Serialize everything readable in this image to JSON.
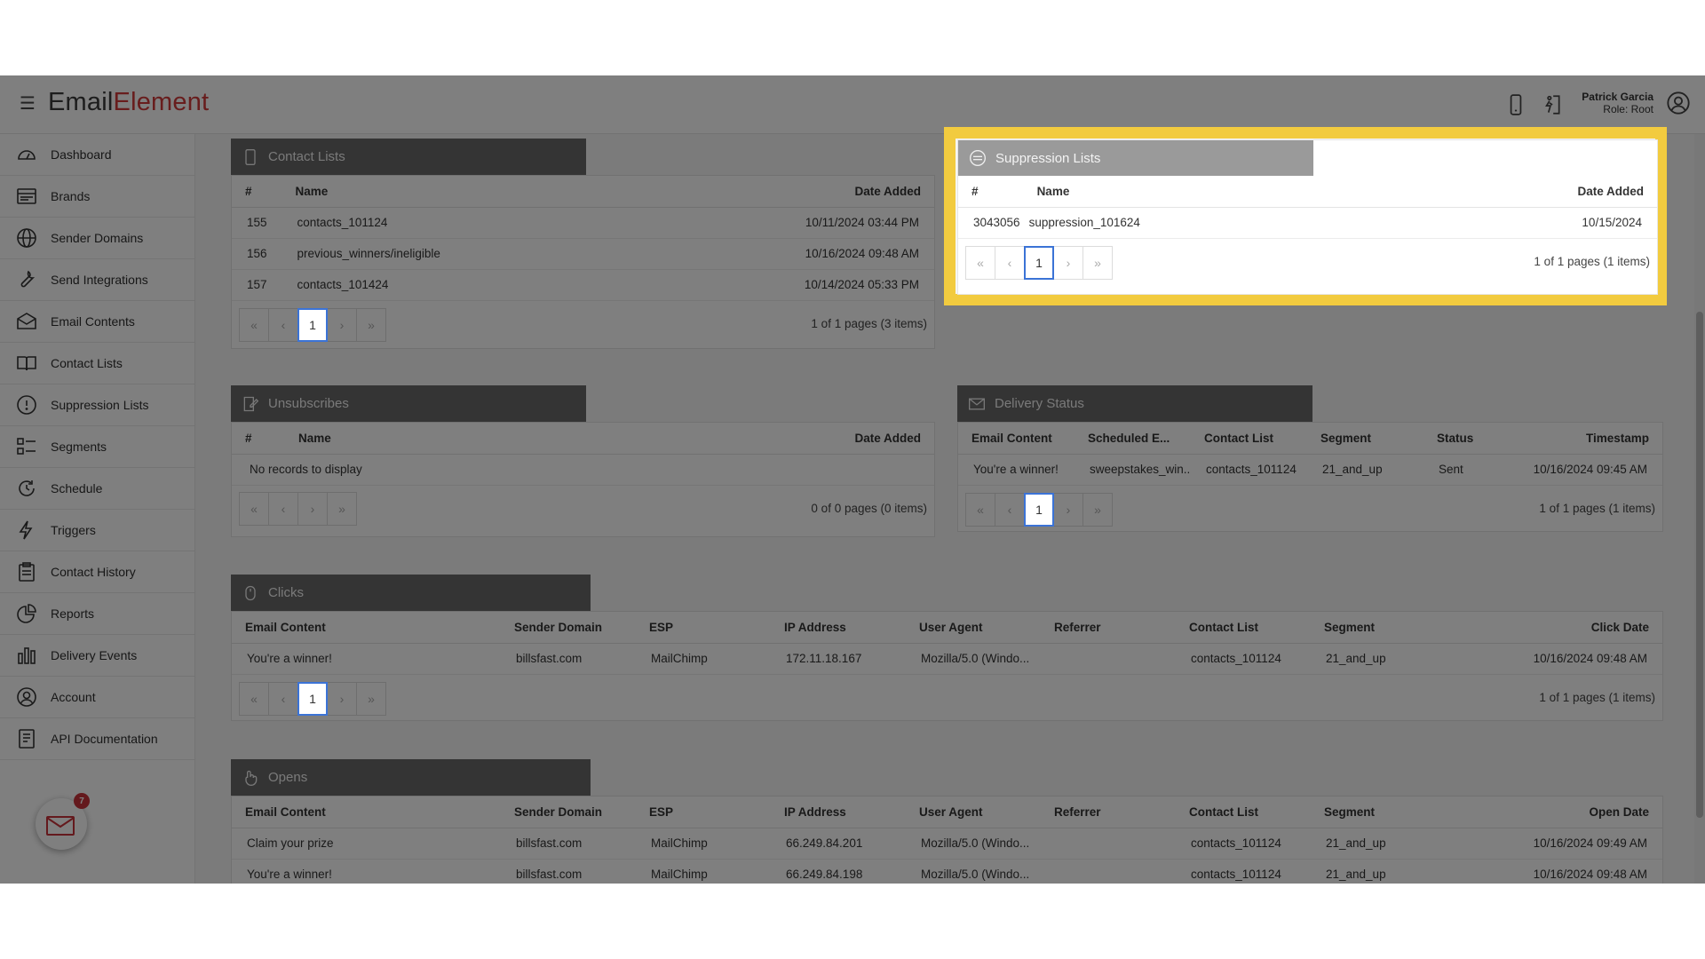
{
  "header": {
    "logo_a": "Em",
    "logo_b": "ail",
    "logo_c": "Element",
    "user_name": "Patrick Garcia",
    "user_role": "Role: Root"
  },
  "sidebar": {
    "items": [
      {
        "label": "Dashboard",
        "icon": "dashboard-icon"
      },
      {
        "label": "Brands",
        "icon": "brands-icon"
      },
      {
        "label": "Sender Domains",
        "icon": "globe-icon"
      },
      {
        "label": "Send Integrations",
        "icon": "wrench-icon"
      },
      {
        "label": "Email Contents",
        "icon": "envelope-icon"
      },
      {
        "label": "Contact Lists",
        "icon": "book-icon"
      },
      {
        "label": "Suppression Lists",
        "icon": "alert-circle-icon"
      },
      {
        "label": "Segments",
        "icon": "segments-icon"
      },
      {
        "label": "Schedule",
        "icon": "clock-icon"
      },
      {
        "label": "Triggers",
        "icon": "lightning-icon"
      },
      {
        "label": "Contact History",
        "icon": "clipboard-icon"
      },
      {
        "label": "Reports",
        "icon": "pie-chart-icon"
      },
      {
        "label": "Delivery Events",
        "icon": "bar-chart-icon"
      },
      {
        "label": "Account",
        "icon": "user-circle-icon"
      },
      {
        "label": "API Documentation",
        "icon": "document-icon"
      }
    ],
    "notification_count": "7"
  },
  "pager": {
    "first": "«",
    "prev": "‹",
    "next": "›",
    "last": "»"
  },
  "contact_lists": {
    "title": "Contact Lists",
    "columns": [
      "#",
      "Name",
      "Date Added"
    ],
    "rows": [
      [
        "155",
        "contacts_101124",
        "10/11/2024 03:44 PM"
      ],
      [
        "156",
        "previous_winners/ineligible",
        "10/16/2024 09:48 AM"
      ],
      [
        "157",
        "contacts_101424",
        "10/14/2024 05:33 PM"
      ]
    ],
    "page": "1",
    "info": "1 of 1 pages (3 items)"
  },
  "suppression_lists": {
    "title": "Suppression Lists",
    "columns": [
      "#",
      "Name",
      "Date Added"
    ],
    "rows": [
      [
        "3043056",
        "suppression_101624",
        "10/15/2024"
      ]
    ],
    "page": "1",
    "info": "1 of 1 pages (1 items)"
  },
  "unsubscribes": {
    "title": "Unsubscribes",
    "columns": [
      "#",
      "Name",
      "Date Added"
    ],
    "empty": "No records to display",
    "info": "0 of 0 pages (0 items)"
  },
  "delivery_status": {
    "title": "Delivery Status",
    "columns": [
      "Email Content",
      "Scheduled E...",
      "Contact List",
      "Segment",
      "Status",
      "Timestamp"
    ],
    "rows": [
      [
        "You're a winner!",
        "sweepstakes_win...",
        "contacts_101124",
        "21_and_up",
        "Sent",
        "10/16/2024 09:45 AM"
      ]
    ],
    "page": "1",
    "info": "1 of 1 pages (1 items)"
  },
  "clicks": {
    "title": "Clicks",
    "columns": [
      "Email Content",
      "Sender Domain",
      "ESP",
      "IP Address",
      "User Agent",
      "Referrer",
      "Contact List",
      "Segment",
      "Click Date"
    ],
    "rows": [
      [
        "You're a winner!",
        "billsfast.com",
        "MailChimp",
        "172.11.18.167",
        "Mozilla/5.0 (Windo...",
        "",
        "contacts_101124",
        "21_and_up",
        "10/16/2024 09:48 AM"
      ]
    ],
    "page": "1",
    "info": "1 of 1 pages (1 items)"
  },
  "opens": {
    "title": "Opens",
    "columns": [
      "Email Content",
      "Sender Domain",
      "ESP",
      "IP Address",
      "User Agent",
      "Referrer",
      "Contact List",
      "Segment",
      "Open Date"
    ],
    "rows": [
      [
        "Claim your prize",
        "billsfast.com",
        "MailChimp",
        "66.249.84.201",
        "Mozilla/5.0 (Windo...",
        "",
        "contacts_101124",
        "21_and_up",
        "10/16/2024 09:49 AM"
      ],
      [
        "You're a winner!",
        "billsfast.com",
        "MailChimp",
        "66.249.84.198",
        "Mozilla/5.0 (Windo...",
        "",
        "contacts_101124",
        "21_and_up",
        "10/16/2024 09:48 AM"
      ]
    ]
  },
  "colors": {
    "highlight": "#f2cb3f",
    "active_page": "#3b73d6",
    "logo_red": "#d13a3a",
    "badge": "#c8333a"
  }
}
